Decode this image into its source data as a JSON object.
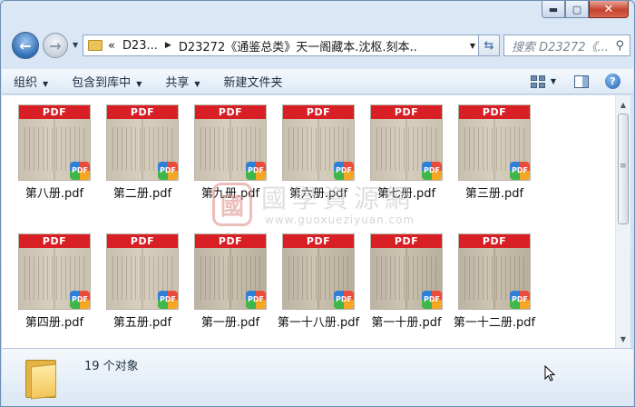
{
  "window": {
    "minimize_glyph": "▬",
    "maximize_glyph": "▢",
    "close_glyph": "✕"
  },
  "nav": {
    "back_glyph": "←",
    "forward_glyph": "→",
    "overflow_glyph": "«",
    "breadcrumb": [
      "D23...",
      "D23272《通鉴总类》天一阁藏本.沈枢.刻本...."
    ],
    "search_placeholder": "搜索 D23272《...",
    "refresh_glyph": "⇆",
    "search_icon": "search-icon"
  },
  "toolbar": {
    "organize": "组织",
    "include_in_library": "包含到库中",
    "share": "共享",
    "new_folder": "新建文件夹",
    "help_glyph": "?"
  },
  "files": [
    {
      "name": "第八册.pdf",
      "banner": "PDF",
      "badge": "PDF"
    },
    {
      "name": "第二册.pdf",
      "banner": "PDF",
      "badge": "PDF"
    },
    {
      "name": "第九册.pdf",
      "banner": "PDF",
      "badge": "PDF"
    },
    {
      "name": "第六册.pdf",
      "banner": "PDF",
      "badge": "PDF"
    },
    {
      "name": "第七册.pdf",
      "banner": "PDF",
      "badge": "PDF"
    },
    {
      "name": "第三册.pdf",
      "banner": "PDF",
      "badge": "PDF"
    },
    {
      "name": "第四册.pdf",
      "banner": "PDF",
      "badge": "PDF"
    },
    {
      "name": "第五册.pdf",
      "banner": "PDF",
      "badge": "PDF"
    },
    {
      "name": "第一册.pdf",
      "banner": "PDF",
      "badge": "PDF"
    },
    {
      "name": "第一十八册.pdf",
      "banner": "PDF",
      "badge": "PDF"
    },
    {
      "name": "第一十册.pdf",
      "banner": "PDF",
      "badge": "PDF"
    },
    {
      "name": "第一十二册.pdf",
      "banner": "PDF",
      "badge": "PDF"
    }
  ],
  "watermark": {
    "seal": "國",
    "text": "國學資源網",
    "url": "www.guoxueziyuan.com"
  },
  "status": {
    "item_count": "19 个对象"
  }
}
